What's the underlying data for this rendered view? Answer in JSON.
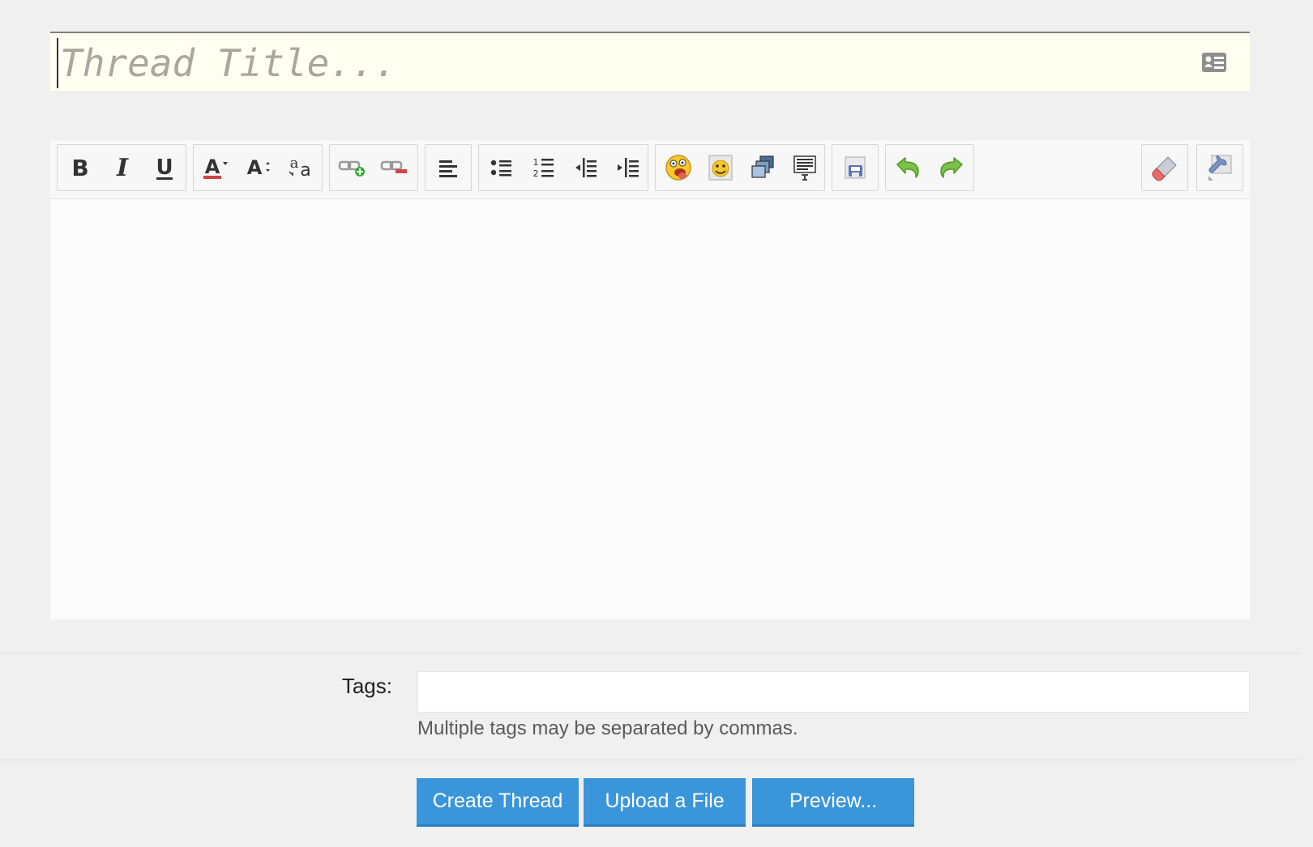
{
  "title_field": {
    "placeholder": "Thread Title...",
    "value": ""
  },
  "toolbar": {
    "groups": [
      [
        "bold-icon",
        "italic-icon",
        "underline-icon"
      ],
      [
        "font-color-icon",
        "font-size-icon",
        "font-family-icon"
      ],
      [
        "insert-link-icon",
        "remove-link-icon"
      ],
      [
        "align-left-icon"
      ],
      [
        "bullet-list-icon",
        "numbered-list-icon",
        "outdent-icon",
        "indent-icon"
      ],
      [
        "smilies-icon",
        "insert-image-icon",
        "insert-media-icon",
        "insert-code-icon"
      ],
      [
        "save-draft-icon"
      ],
      [
        "undo-icon",
        "redo-icon"
      ],
      [
        "remove-formatting-icon"
      ],
      [
        "toggle-bbcode-icon"
      ]
    ]
  },
  "tags": {
    "label": "Tags:",
    "value": "",
    "hint": "Multiple tags may be separated by commas."
  },
  "actions": {
    "create_thread": "Create Thread",
    "upload_file": "Upload a File",
    "preview": "Preview..."
  },
  "colors": {
    "page_bg": "#f0f0f0",
    "title_bg": "#fefff0",
    "primary_button": "#3a95db",
    "editor_bg": "#fcfcfc"
  }
}
